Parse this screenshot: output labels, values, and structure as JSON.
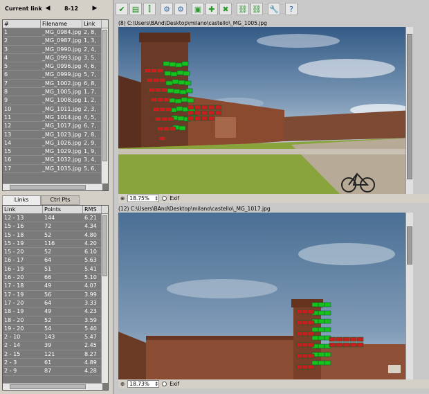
{
  "links_header": {
    "title": "Current link",
    "prev": "◀",
    "next": "▶",
    "current": "8-12"
  },
  "images_table": {
    "columns": [
      "#",
      "Filename",
      "Link"
    ],
    "rows": [
      [
        "1",
        "_MG_0984.jpg",
        "2, 8,"
      ],
      [
        "2",
        "_MG_0987.jpg",
        "1, 3,"
      ],
      [
        "3",
        "_MG_0990.jpg",
        "2, 4,"
      ],
      [
        "4",
        "_MG_0993.jpg",
        "3, 5,"
      ],
      [
        "5",
        "_MG_0996.jpg",
        "4, 6,"
      ],
      [
        "6",
        "_MG_0999.jpg",
        "5, 7,"
      ],
      [
        "7",
        "_MG_1002.jpg",
        "6, 8,"
      ],
      [
        "8",
        "_MG_1005.jpg",
        "1, 7,"
      ],
      [
        "9",
        "_MG_1008.jpg",
        "1, 2,"
      ],
      [
        "10",
        "_MG_1011.jpg",
        "2, 3,"
      ],
      [
        "11",
        "_MG_1014.jpg",
        "4, 5,"
      ],
      [
        "12",
        "_MG_1017.jpg",
        "6, 7,"
      ],
      [
        "13",
        "_MG_1023.jpg",
        "7, 8,"
      ],
      [
        "14",
        "_MG_1026.jpg",
        "2, 9,"
      ],
      [
        "15",
        "_MG_1029.jpg",
        "1, 9,"
      ],
      [
        "16",
        "_MG_1032.jpg",
        "3, 4,"
      ],
      [
        "17",
        "_MG_1035.jpg",
        "5, 6,"
      ]
    ]
  },
  "tabs": [
    "Links",
    "Ctrl Pts"
  ],
  "links_table": {
    "columns": [
      "Link",
      "Points",
      "RMS"
    ],
    "rows": [
      [
        "12 - 13",
        "144",
        "6.21"
      ],
      [
        "15 - 16",
        "72",
        "4.34"
      ],
      [
        "15 - 18",
        "52",
        "4.80"
      ],
      [
        "15 - 19",
        "116",
        "4.20"
      ],
      [
        "15 - 20",
        "52",
        "6.10"
      ],
      [
        "16 - 17",
        "64",
        "5.63"
      ],
      [
        "16 - 19",
        "51",
        "5.41"
      ],
      [
        "16 - 20",
        "66",
        "5.10"
      ],
      [
        "17 - 18",
        "49",
        "4.07"
      ],
      [
        "17 - 19",
        "56",
        "3.99"
      ],
      [
        "17 - 20",
        "64",
        "3.33"
      ],
      [
        "18 - 19",
        "49",
        "4.23"
      ],
      [
        "18 - 20",
        "52",
        "3.59"
      ],
      [
        "19 - 20",
        "54",
        "5.40"
      ],
      [
        "2 - 10",
        "143",
        "5.47"
      ],
      [
        "2 - 14",
        "39",
        "2.45"
      ],
      [
        "2 - 15",
        "121",
        "8.27"
      ],
      [
        "2 - 3",
        "61",
        "4.89"
      ],
      [
        "2 - 9",
        "87",
        "4.28"
      ]
    ]
  },
  "toolbar": {
    "icons": [
      "check-down-icon",
      "film-strip-icon",
      "split-icon",
      "gears-icon",
      "gears-red-icon",
      "add-frame-icon",
      "add-points-icon",
      "remove-points-icon",
      "link-green-icon",
      "unlink-green-icon",
      "wrench-icon",
      "help-icon"
    ],
    "glyphs": [
      "✔",
      "▤",
      "⫿",
      "⚙",
      "⚙",
      "▣",
      "✚",
      "✖",
      "⛓",
      "⛓",
      "🔧",
      "?"
    ]
  },
  "top_image": {
    "path": "(8) C:\\Users\\BAnd\\Desktop\\milano\\castello\\_MG_1005.jpg",
    "zoom": "18.75%",
    "exif": "Exif"
  },
  "bottom_image": {
    "path": "(12) C:\\Users\\BAnd\\Desktop\\milano\\castello\\_MG_1017.jpg",
    "zoom": "18.73%",
    "exif": "Exif"
  },
  "colors": {
    "cp_green": "#19c21a",
    "cp_red": "#c81e1e",
    "cp_white": "#ffffff",
    "sky": "#4a6f94",
    "grass": "#7a9a2a"
  }
}
